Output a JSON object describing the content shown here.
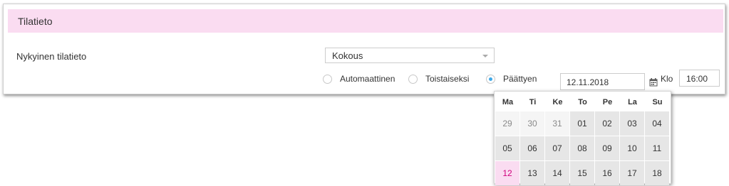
{
  "section": {
    "title": "Tilatieto"
  },
  "status": {
    "label": "Nykyinen tilatieto",
    "select_value": "Kokous"
  },
  "radios": [
    {
      "label": "Automaattinen",
      "checked": false
    },
    {
      "label": "Toistaiseksi",
      "checked": false
    },
    {
      "label": "Päättyen",
      "checked": true
    }
  ],
  "date": {
    "value": "12.11.2018"
  },
  "time": {
    "label": "Klo",
    "value": "16:00"
  },
  "calendar": {
    "weekdays": [
      "Ma",
      "Ti",
      "Ke",
      "To",
      "Pe",
      "La",
      "Su"
    ],
    "weeks": [
      [
        "29",
        "30",
        "31",
        "01",
        "02",
        "03",
        "04"
      ],
      [
        "05",
        "06",
        "07",
        "08",
        "09",
        "10",
        "11"
      ],
      [
        "12",
        "13",
        "14",
        "15",
        "16",
        "17",
        "18"
      ]
    ],
    "other_month_days": [
      "29",
      "30",
      "31"
    ],
    "selected_day": "12"
  },
  "colors": {
    "header_bg": "#fadcf1",
    "selected_text": "#d0007d",
    "radio_accent": "#3fa9e8"
  }
}
